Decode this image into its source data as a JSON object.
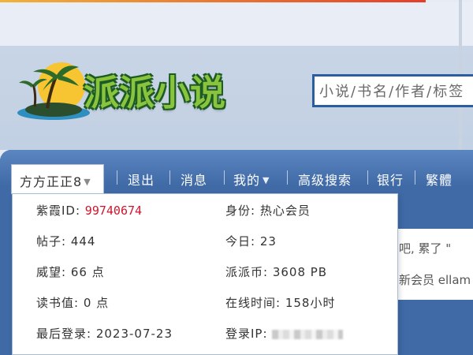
{
  "header": {
    "logo_text": "派派小说",
    "search_placeholder": "小说/书名/作者/标签"
  },
  "nav": {
    "user_name": "方方正正8",
    "items": [
      "退出",
      "消息",
      "我的",
      "高级搜索",
      "银行",
      "繁體"
    ]
  },
  "profile": {
    "id_label": "紫霞ID: ",
    "id_value": "99740674",
    "role": "身份: 热心会员",
    "posts": "帖子: 444",
    "today": "今日: 23",
    "reputation": "威望: 66 点",
    "coins": "派派币: 3608 PB",
    "reading": "读书值: 0 点",
    "online_time": "在线时间: 158小时",
    "last_login": "最后登录: 2023-07-23",
    "login_ip_label": "登录IP: "
  },
  "content": {
    "line1": "吧, 累了 \"",
    "line2": "新会员 ellam"
  },
  "colors": {
    "nav_blue": "#3f6aa7",
    "search_border": "#2b5ea1",
    "id_red": "#d0142c",
    "logo_green": "#8ac43e"
  }
}
